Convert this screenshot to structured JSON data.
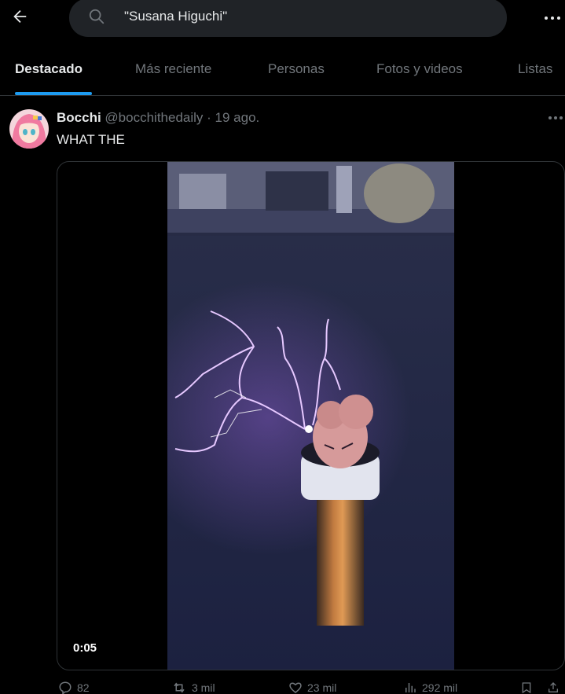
{
  "search": {
    "query": "\"Susana Higuchi\""
  },
  "tabs": [
    {
      "label": "Destacado"
    },
    {
      "label": "Más reciente"
    },
    {
      "label": "Personas"
    },
    {
      "label": "Fotos y videos"
    },
    {
      "label": "Listas"
    }
  ],
  "tweet": {
    "name": "Bocchi",
    "handle": "@bocchithedaily",
    "separator": " · ",
    "date": "19 ago.",
    "text": "WHAT THE",
    "video_time": "0:05",
    "replies": "82",
    "retweets": "3 mil",
    "likes": "23 mil",
    "views": "292 mil"
  },
  "colors": {
    "accent": "#1d9bf0",
    "background": "#000000",
    "search_bg": "#202327",
    "muted_text": "#71767b",
    "divider": "#2f3336"
  }
}
